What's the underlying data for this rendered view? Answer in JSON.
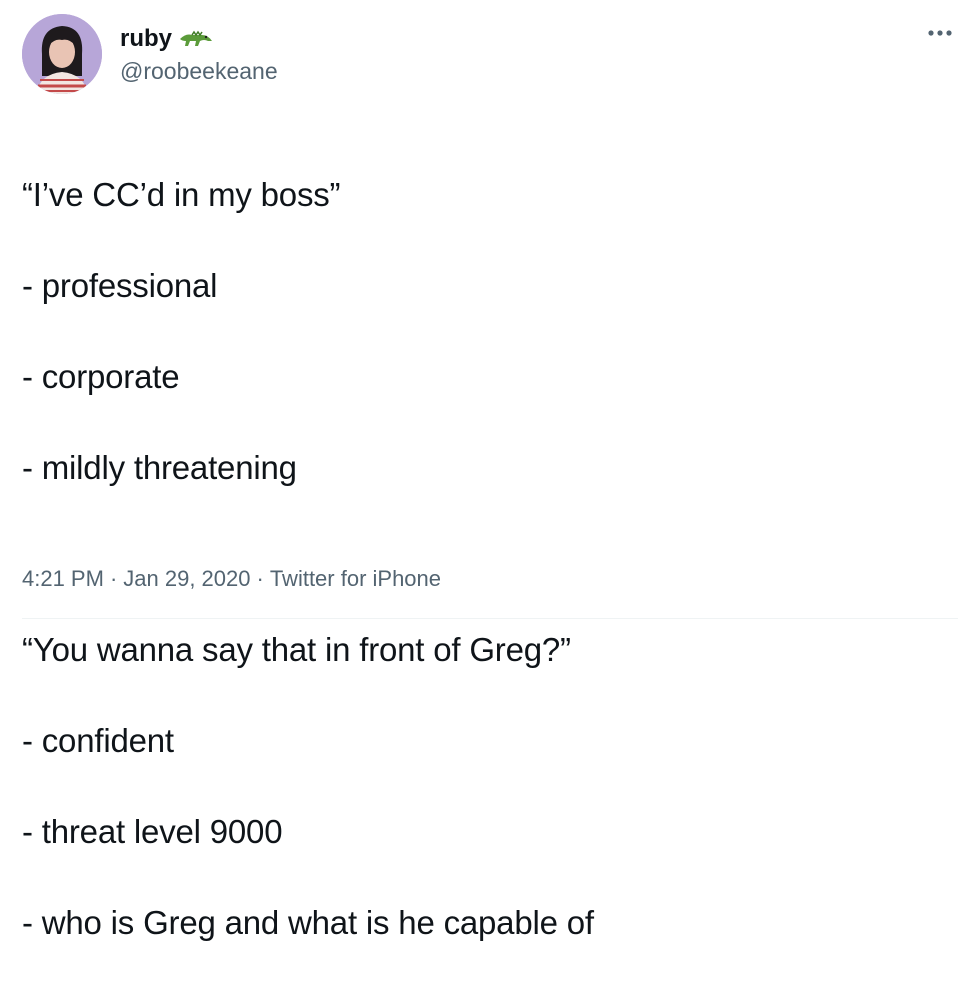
{
  "author": {
    "display_name": "ruby",
    "emoji_icon": "crocodile-icon",
    "handle": "@roobeekeane"
  },
  "tweet": {
    "lines": [
      "“I’ve CC’d in my boss”",
      "- professional",
      "- corporate",
      "- mildly threatening",
      "",
      "“You wanna say that in front of Greg?”",
      "- confident",
      "- threat level 9000",
      "- who is Greg and what is he capable of"
    ]
  },
  "meta": {
    "time": "4:21 PM",
    "separator": "·",
    "date": "Jan 29, 2020",
    "source": "Twitter for iPhone"
  },
  "colors": {
    "text": "#0f1419",
    "secondary": "#536471",
    "emoji_green": "#5b9b3a"
  }
}
